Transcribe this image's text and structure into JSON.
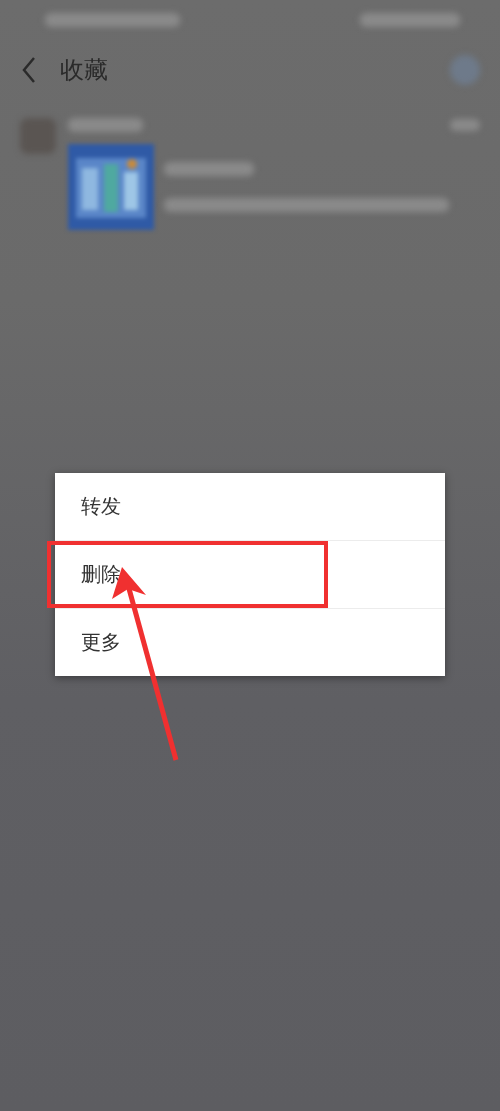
{
  "header": {
    "title": "收藏"
  },
  "menu": {
    "items": [
      {
        "label": "转发",
        "highlighted": false
      },
      {
        "label": "删除",
        "highlighted": true
      },
      {
        "label": "更多",
        "highlighted": false
      }
    ]
  }
}
